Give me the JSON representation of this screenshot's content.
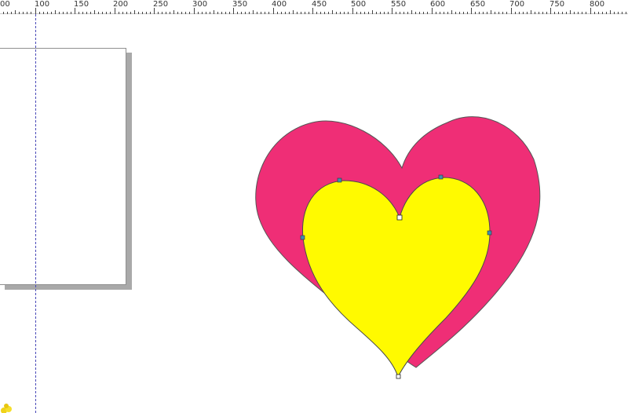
{
  "ruler": {
    "labels": [
      "00",
      "100",
      "150",
      "200",
      "250",
      "300",
      "350",
      "400",
      "450",
      "500",
      "550",
      "600",
      "650",
      "700",
      "750",
      "800"
    ]
  },
  "colors": {
    "pink_heart": "#ef2e76",
    "yellow_heart": "#fffa00",
    "outline": "#555555",
    "guide": "#4a4ab8",
    "page_shadow": "#a9a9a9"
  },
  "shapes": {
    "back_heart": "pink-heart",
    "front_heart": "yellow-heart-selected"
  }
}
